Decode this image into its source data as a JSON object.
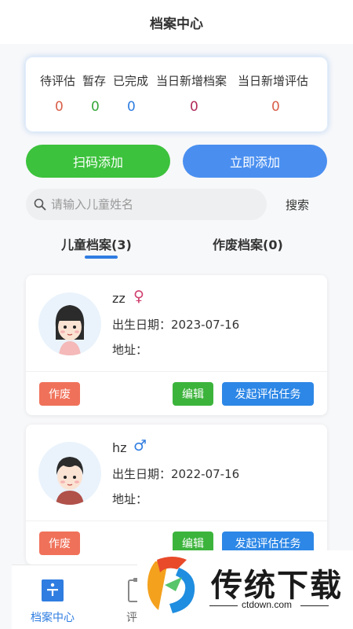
{
  "header": {
    "title": "档案中心"
  },
  "stats": [
    {
      "label": "待评估",
      "value": "0",
      "color": "#d95f4a"
    },
    {
      "label": "暂存",
      "value": "0",
      "color": "#36a63a"
    },
    {
      "label": "已完成",
      "value": "0",
      "color": "#2f7de1"
    },
    {
      "label": "当日新增档案",
      "value": "0",
      "color": "#b02a5a"
    },
    {
      "label": "当日新增评估",
      "value": "0",
      "color": "#d95f4a"
    }
  ],
  "actions": {
    "scan_label": "扫码添加",
    "add_label": "立即添加"
  },
  "search": {
    "placeholder": "请输入儿童姓名",
    "value": "",
    "button_label": "搜索"
  },
  "tabs": [
    {
      "label": "儿童档案(3)",
      "active": true
    },
    {
      "label": "作废档案(0)",
      "active": false
    }
  ],
  "records": [
    {
      "name": "zz",
      "gender_icon": "female-icon",
      "gender_symbol": "♀",
      "gender_color": "#d0406e",
      "birth": "出生日期：2023-07-16",
      "address": "地址：",
      "void_label": "作废",
      "edit_label": "编辑",
      "task_label": "发起评估任务"
    },
    {
      "name": "hz",
      "gender_icon": "male-icon",
      "gender_symbol": "♂",
      "gender_color": "#2f7de1",
      "birth": "出生日期：2022-07-16",
      "address": "地址：",
      "void_label": "作废",
      "edit_label": "编辑",
      "task_label": "发起评估任务"
    }
  ],
  "tabbar": [
    {
      "label": "档案中心",
      "active": true,
      "icon": "archive-icon"
    },
    {
      "label": "评估",
      "active": false,
      "icon": "assessment-icon"
    }
  ],
  "watermark": {
    "brand": "传统下载",
    "site": "ctdown.com"
  },
  "colors": {
    "primary_blue": "#2f7de1",
    "green": "#3cc23c",
    "void_red": "#f0715a"
  }
}
